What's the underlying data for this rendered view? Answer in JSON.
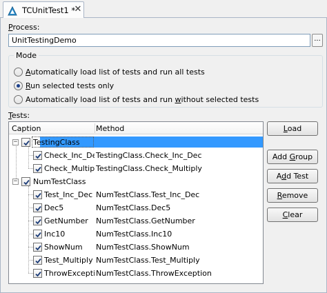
{
  "tab": {
    "title": "TCUnitTest1 *",
    "icon": "unit-test-icon",
    "close": "✕"
  },
  "process": {
    "label_accel": "P",
    "label_rest": "rocess:",
    "value": "UnitTestingDemo",
    "browse_label": "..."
  },
  "mode": {
    "title": "Mode",
    "options": [
      {
        "before": "",
        "accel": "A",
        "after": "utomatically load list of tests and run all tests",
        "selected": false
      },
      {
        "before": "",
        "accel": "R",
        "after": "un selected tests only",
        "selected": true
      },
      {
        "before": "Automatically load list of tests and run ",
        "accel": "w",
        "after": "ithout selected tests",
        "selected": false
      }
    ]
  },
  "tests": {
    "label_accel": "T",
    "label_rest": "ests:",
    "columns": {
      "caption": "Caption",
      "method": "Method"
    },
    "rows": [
      {
        "level": 0,
        "caption": "TestingClass",
        "method": "",
        "checked": true,
        "expanded": true,
        "selected": true
      },
      {
        "level": 1,
        "caption": "Check_Inc_Dec",
        "method": "TestingClass.Check_Inc_Dec",
        "checked": true
      },
      {
        "level": 1,
        "caption": "Check_Multiply",
        "method": "TestingClass.Check_Multiply",
        "checked": true
      },
      {
        "level": 0,
        "caption": "NumTestClass",
        "method": "",
        "checked": true,
        "expanded": true,
        "selected": false
      },
      {
        "level": 1,
        "caption": "Test_Inc_Dec",
        "method": "NumTestClass.Test_Inc_Dec",
        "checked": true
      },
      {
        "level": 1,
        "caption": "Dec5",
        "method": "NumTestClass.Dec5",
        "checked": true
      },
      {
        "level": 1,
        "caption": "GetNumber",
        "method": "NumTestClass.GetNumber",
        "checked": true
      },
      {
        "level": 1,
        "caption": "Inc10",
        "method": "NumTestClass.Inc10",
        "checked": true
      },
      {
        "level": 1,
        "caption": "ShowNum",
        "method": "NumTestClass.ShowNum",
        "checked": true
      },
      {
        "level": 1,
        "caption": "Test_Multiply",
        "method": "NumTestClass.Test_Multiply",
        "checked": true
      },
      {
        "level": 1,
        "caption": "ThrowException",
        "method": "NumTestClass.ThrowException",
        "checked": true
      }
    ]
  },
  "buttons": [
    {
      "name": "load-button",
      "before": "",
      "accel": "L",
      "after": "oad"
    },
    {
      "name": "add-group-button",
      "before": "Add ",
      "accel": "G",
      "after": "roup"
    },
    {
      "name": "add-test-button",
      "before": "A",
      "accel": "d",
      "after": "d Test"
    },
    {
      "name": "remove-button",
      "before": "",
      "accel": "R",
      "after": "emove"
    },
    {
      "name": "clear-button",
      "before": "",
      "accel": "C",
      "after": "lear"
    }
  ],
  "colors": {
    "selection": "#3399ff",
    "border": "#a9b5c6"
  }
}
